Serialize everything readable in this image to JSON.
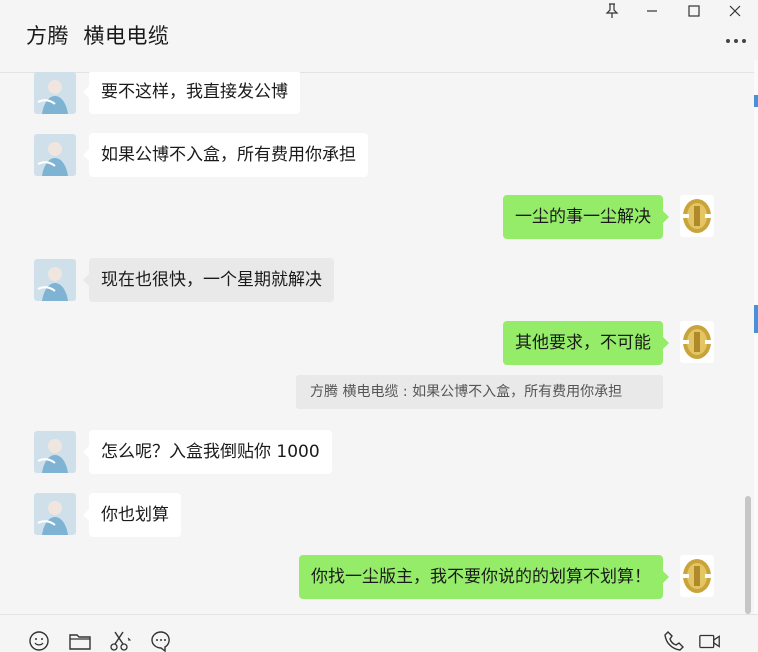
{
  "window": {
    "title": "方腾  横电电缆",
    "pin_icon": "pin-icon",
    "minimize_icon": "minimize-icon",
    "maximize_icon": "maximize-icon",
    "close_icon": "close-icon",
    "more_icon": "more-icon"
  },
  "messages": [
    {
      "side": "left",
      "text": "要不这样，我直接发公博",
      "style": "white"
    },
    {
      "side": "left",
      "text": "如果公博不入盒，所有费用你承担",
      "style": "white"
    },
    {
      "side": "right",
      "text": "一尘的事一尘解决"
    },
    {
      "side": "left",
      "text": "现在也很快，一个星期就解决",
      "style": "gray"
    },
    {
      "side": "right",
      "text": "其他要求，不可能"
    },
    {
      "side": "quote",
      "text": "方腾  横电电缆 : 如果公博不入盒，所有费用你承担"
    },
    {
      "side": "left",
      "text": "怎么呢？入盒我倒贴你 1000",
      "style": "white"
    },
    {
      "side": "left",
      "text": "你也划算",
      "style": "white"
    },
    {
      "side": "right",
      "text": "你找一尘版主，我不要你说的的划算不划算！"
    }
  ],
  "toolbar": {
    "icons": [
      "emoji-icon",
      "folder-icon",
      "scissors-icon",
      "chat-history-icon",
      "phone-icon",
      "video-call-icon"
    ]
  },
  "colors": {
    "background": "#f5f5f5",
    "sent_bubble": "#95ec69",
    "received_bubble": "#ffffff",
    "received_bubble_highlight": "#e9e9e9"
  }
}
